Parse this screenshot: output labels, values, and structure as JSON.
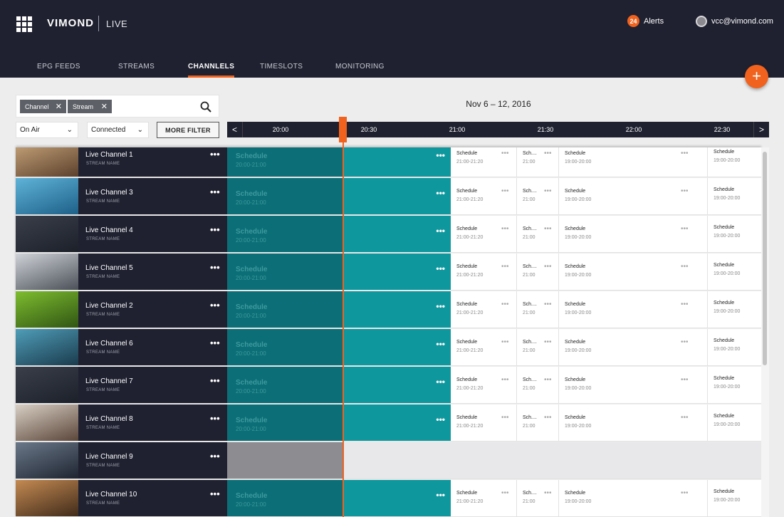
{
  "header": {
    "brand": "VIMOND",
    "product": "LIVE",
    "alerts_count": "24",
    "alerts_label": "Alerts",
    "user_email": "vcc@vimond.com"
  },
  "nav": {
    "tabs": [
      {
        "label": "EPG FEEDS",
        "active": false
      },
      {
        "label": "STREAMS",
        "active": false
      },
      {
        "label": "CHANNLELS",
        "active": true
      },
      {
        "label": "TIMESLOTS",
        "active": false
      },
      {
        "label": "MONITORING",
        "active": false
      }
    ]
  },
  "fab_label": "+",
  "filters": {
    "chips": [
      "Channel",
      "Stream"
    ],
    "status_select": "On Air",
    "connection_select": "Connected",
    "more_filter": "MORE FILTER"
  },
  "timeline": {
    "date_range": "Nov 6 – 12, 2016",
    "ticks": [
      "20:00",
      "20:30",
      "21:00",
      "21:30",
      "22:00",
      "22:30"
    ],
    "prev": "<",
    "next": ">"
  },
  "schedule": {
    "title": "Schedule",
    "current_time": "20:00-21:00",
    "slot_a_title": "Schedule",
    "slot_a_time": "21:00-21:20",
    "slot_b_title": "Sch....",
    "slot_b_time": "21:00",
    "slot_c_title": "Schedule",
    "slot_c_time": "19:00-20:00",
    "slot_d_title": "Schedule",
    "slot_d_time": "19:00-20:00",
    "more": "•••"
  },
  "stream_name_label": "STREAM NAME",
  "channels": [
    {
      "name": "Live Channel 1",
      "scheduled": true,
      "thumb": [
        "#c9a77c",
        "#5b3f2b"
      ]
    },
    {
      "name": "Live Channel 3",
      "scheduled": true,
      "thumb": [
        "#5fb3d8",
        "#1d5f87"
      ]
    },
    {
      "name": "Live Channel 4",
      "scheduled": true,
      "thumb": [
        "#3a3f4a",
        "#1b2029"
      ]
    },
    {
      "name": "Live Channel 5",
      "scheduled": true,
      "thumb": [
        "#cfd3d8",
        "#4a4f57"
      ]
    },
    {
      "name": "Live Channel 2",
      "scheduled": true,
      "thumb": [
        "#7ebd2f",
        "#2f5413"
      ]
    },
    {
      "name": "Live Channel 6",
      "scheduled": true,
      "thumb": [
        "#4f9db8",
        "#1a3a4c"
      ]
    },
    {
      "name": "Live Channel 7",
      "scheduled": true,
      "thumb": [
        "#3a3f4a",
        "#1b2029"
      ]
    },
    {
      "name": "Live Channel 8",
      "scheduled": true,
      "thumb": [
        "#d8cfc4",
        "#5a4438"
      ]
    },
    {
      "name": "Live Channel 9",
      "scheduled": false,
      "thumb": [
        "#6a7889",
        "#1e2430"
      ]
    },
    {
      "name": "Live Channel 10",
      "scheduled": true,
      "thumb": [
        "#c48a52",
        "#3f2a1a"
      ]
    }
  ],
  "colors": {
    "accent": "#f0621e",
    "header_bg": "#1f2130",
    "schedule_current": "#0f979e",
    "schedule_past": "#0c6e76"
  }
}
